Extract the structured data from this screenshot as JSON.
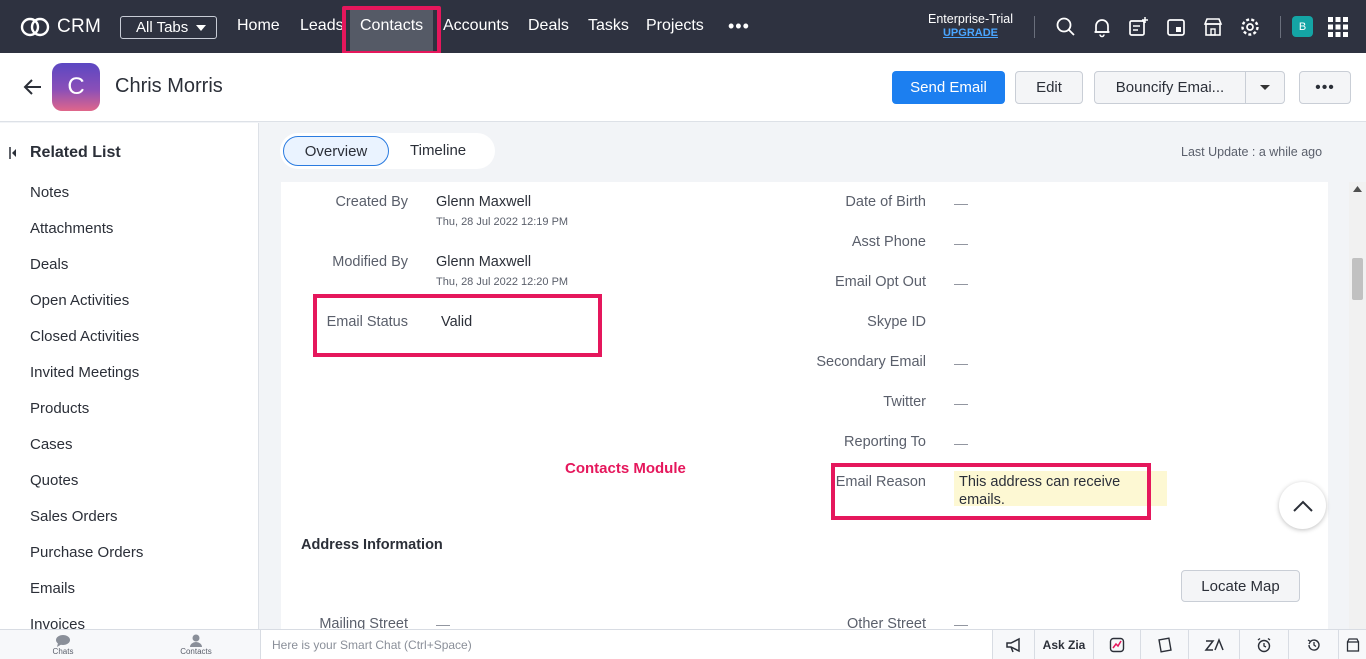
{
  "app": {
    "name": "CRM"
  },
  "nav": {
    "all_tabs": "All Tabs",
    "links": [
      "Home",
      "Leads",
      "Contacts",
      "Accounts",
      "Deals",
      "Tasks",
      "Projects"
    ],
    "active": "Contacts",
    "more": "•••",
    "plan": "Enterprise-Trial",
    "upgrade": "UPGRADE",
    "user_initial": "B"
  },
  "record": {
    "avatar_initial": "C",
    "name": "Chris Morris",
    "send_email": "Send Email",
    "edit": "Edit",
    "bouncify": "Bouncify Emai...",
    "more": "•••"
  },
  "related_list": {
    "title": "Related List",
    "items": [
      "Notes",
      "Attachments",
      "Deals",
      "Open Activities",
      "Closed Activities",
      "Invited Meetings",
      "Products",
      "Cases",
      "Quotes",
      "Sales Orders",
      "Purchase Orders",
      "Emails",
      "Invoices"
    ]
  },
  "tabs": {
    "overview": "Overview",
    "timeline": "Timeline"
  },
  "last_update": "Last Update : a while ago",
  "fields_left": [
    {
      "label": "Created By",
      "value": "Glenn Maxwell",
      "sub": "Thu, 28 Jul 2022 12:19 PM"
    },
    {
      "label": "Modified By",
      "value": "Glenn Maxwell",
      "sub": "Thu, 28 Jul 2022 12:20 PM"
    },
    {
      "label": "Email Status",
      "value": "Valid"
    }
  ],
  "fields_right": [
    {
      "label": "Date of Birth",
      "value": "—"
    },
    {
      "label": "Asst Phone",
      "value": "—"
    },
    {
      "label": "Email Opt Out",
      "value": "—"
    },
    {
      "label": "Skype ID",
      "value": ""
    },
    {
      "label": "Secondary Email",
      "value": "—"
    },
    {
      "label": "Twitter",
      "value": "—"
    },
    {
      "label": "Reporting To",
      "value": "—"
    },
    {
      "label": "Email Reason",
      "value": "This address can receive emails."
    }
  ],
  "annotation": "Contacts Module",
  "address": {
    "title": "Address Information",
    "locate_map": "Locate Map",
    "mailing_street_label": "Mailing Street",
    "mailing_street_value": "—",
    "other_street_label": "Other Street",
    "other_street_value": "—"
  },
  "bottom": {
    "chats": "Chats",
    "contacts": "Contacts",
    "smart_chat_placeholder": "Here is your Smart Chat (Ctrl+Space)",
    "ask_zia": "Ask Zia"
  },
  "colors": {
    "accent": "#1c7ff0",
    "nav_bg": "#2e3240",
    "annotation": "#e5175c",
    "highlight": "#fdf8d3"
  }
}
